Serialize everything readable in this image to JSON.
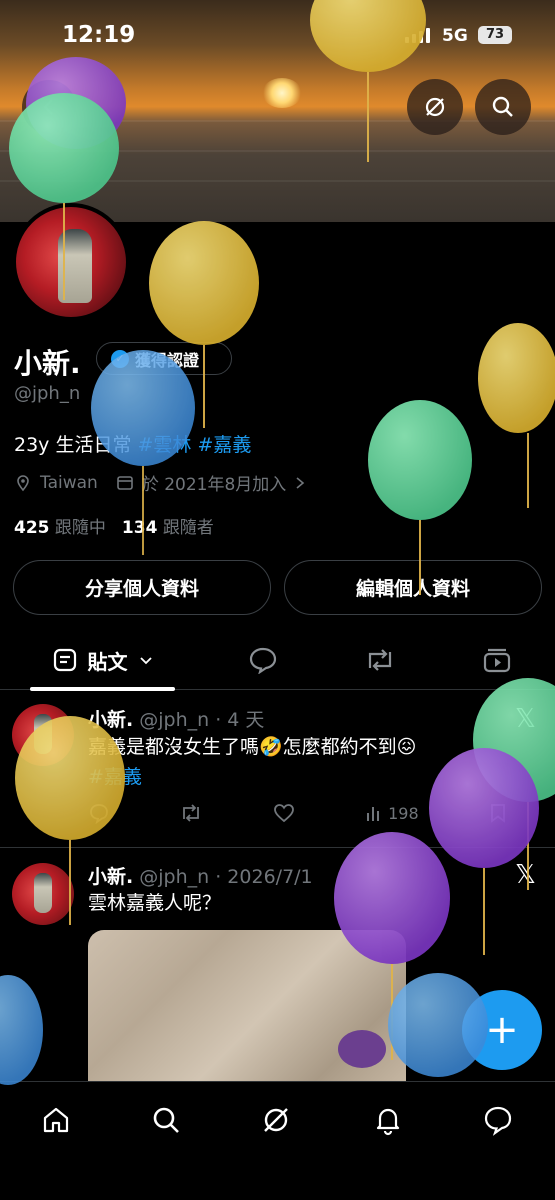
{
  "status_bar": {
    "time": "12:19",
    "network": "5G",
    "battery": "73"
  },
  "profile": {
    "name": "小新.",
    "verify_label": "獲得認證",
    "handle": "@jph_n",
    "bio_text": "23y 生活日常 ",
    "bio_tags": [
      "#雲林",
      "#嘉義"
    ],
    "location": "Taiwan",
    "joined": "於 2021年8月加入",
    "following_count": "425",
    "following_label": "跟隨中",
    "followers_count": "134",
    "followers_label": "跟隨者",
    "share_button": "分享個人資料",
    "edit_button": "編輯個人資料"
  },
  "tabs": {
    "posts_label": "貼文"
  },
  "posts": [
    {
      "name": "小新.",
      "handle_time": "@jph_n · 4 天",
      "text": "嘉義是都沒女生了嗎🤣怎麼都約不到😖",
      "tag": "#嘉義",
      "views": "198"
    },
    {
      "name": "小新.",
      "handle_time": "@jph_n · 2026/7/1",
      "text": "雲林嘉義人呢？"
    }
  ],
  "fab_label": "+",
  "icons": {
    "back": "back-arrow-icon",
    "grok": "grok-icon",
    "search": "search-icon",
    "verified": "verified-badge-icon",
    "location": "location-pin-icon",
    "calendar": "calendar-icon",
    "chevron": "chevron-right-icon",
    "posts_tab": "posts-tab-icon",
    "replies_tab": "reply-bubble-icon",
    "reposts_tab": "repost-icon",
    "media_tab": "media-play-icon",
    "x_logo": "x-logo-icon",
    "home": "home-icon",
    "notifications": "bell-icon",
    "messages": "chat-bubble-icon"
  },
  "colors": {
    "accent": "#1d9bf0",
    "background": "#000000",
    "secondary_text": "#71767b"
  }
}
